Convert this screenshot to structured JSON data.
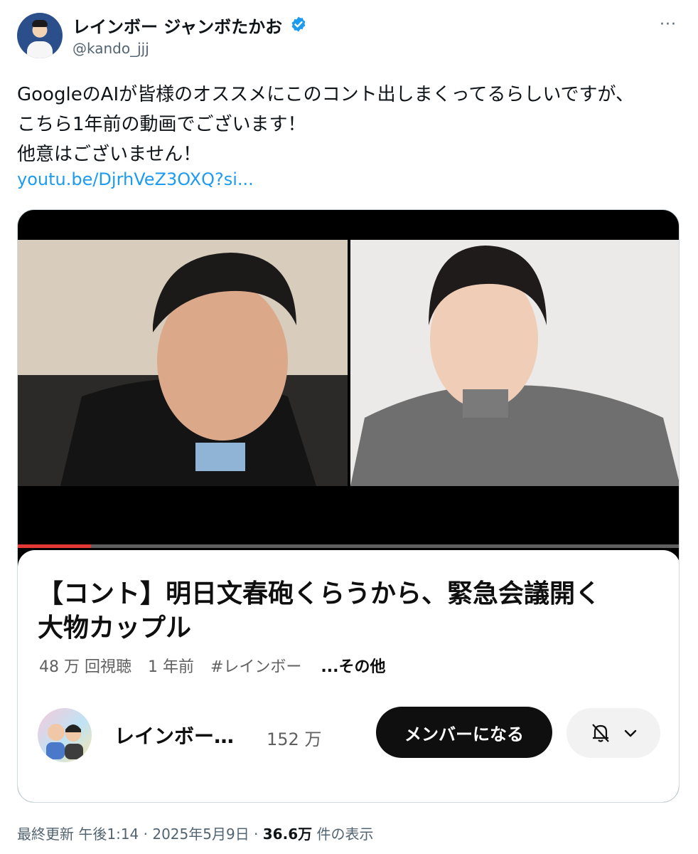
{
  "author": {
    "display_name": "レインボー ジャンボたかお",
    "handle": "@kando_jjj",
    "verified_icon": "verified-badge-icon",
    "more_icon": "more-icon",
    "more_label": "···"
  },
  "tweet": {
    "lines": [
      "GoogleのAIが皆様のオススメにこのコント出しまくってるらしいですが、",
      "こちら1年前の動画でございます！",
      "他意はございません！"
    ],
    "link_text": "youtu.be/DjrhVeZ3OXQ?si..."
  },
  "video_card": {
    "title_line1": "【コント】明日文春砲くらうから、緊急会議開く",
    "title_line2": "大物カップル",
    "views": "48 万 回視聴",
    "age": "1 年前",
    "hashtag": "#レインボー",
    "more_text": "...その他",
    "channel_name": "レインボー…",
    "subscribers": "152 万",
    "member_button": "メンバーになる",
    "bell_icon": "bell-off-icon",
    "chevron_icon": "chevron-down-icon",
    "progress_fraction": 0.11,
    "progress_color": "#e53935"
  },
  "footer": {
    "prefix": "最終更新 午後1:14 · 2025年5月9日 · ",
    "views_count": "36.6万",
    "views_suffix": " 件の表示"
  },
  "colors": {
    "link": "#1d9bf0",
    "secondary_text": "#536471",
    "button_dark": "#0f0f0f"
  }
}
